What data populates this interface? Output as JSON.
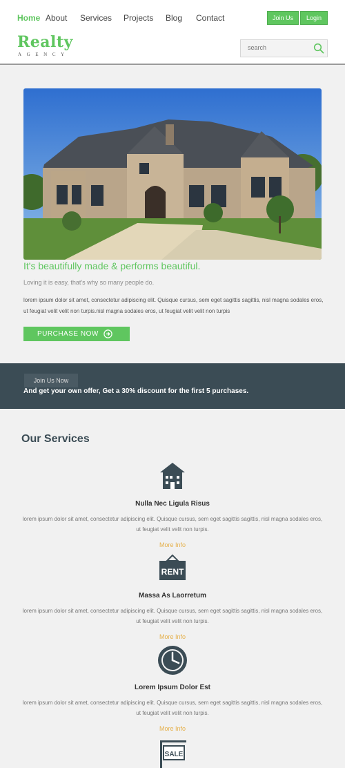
{
  "header": {
    "nav": [
      "Home",
      "About",
      "Services",
      "Projects",
      "Blog",
      "Contact"
    ],
    "join_label": "Join Us",
    "login_label": "Login",
    "logo_main": "Realty",
    "logo_sub": "AGENCY",
    "search_placeholder": "search"
  },
  "hero": {
    "title": "It's beautifully made & performs beautiful.",
    "subtitle": "Loving it is easy, that's why so many people do.",
    "body": "lorem ipsum dolor sit amet, consectetur adipiscing elit. Quisque cursus, sem eget sagittis sagittis, nisl magna sodales eros, ut feugiat velit velit non turpis.nisl magna sodales eros, ut feugiat velit velit non turpis",
    "purchase_label": "PURCHASE NOW"
  },
  "offer": {
    "join_now_label": "Join Us Now",
    "text": "And get your own offer, Get a 30% discount for the first 5 purchases."
  },
  "services": {
    "title": "Our Services",
    "items": [
      {
        "icon": "house-icon",
        "name": "Nulla Nec Ligula Risus",
        "desc": "lorem ipsum dolor sit amet, consectetur adipiscing elit. Quisque cursus, sem eget sagittis sagittis, nisl magna sodales eros, ut feugiat velit velit non turpis.",
        "more": "More Info"
      },
      {
        "icon": "rent-sign-icon",
        "icon_text": "RENT",
        "name": "Massa As Laorretum",
        "desc": "lorem ipsum dolor sit amet, consectetur adipiscing elit. Quisque cursus, sem eget sagittis sagittis, nisl magna sodales eros, ut feugiat velit velit non turpis.",
        "more": "More Info"
      },
      {
        "icon": "clock-icon",
        "name": "Lorem Ipsum Dolor Est",
        "desc": "lorem ipsum dolor sit amet, consectetur adipiscing elit. Quisque cursus, sem eget sagittis sagittis, nisl magna sodales eros, ut feugiat velit velit non turpis.",
        "more": "More Info"
      },
      {
        "icon": "sale-sign-icon",
        "icon_text": "SALE"
      }
    ]
  },
  "colors": {
    "accent_green": "#5fc65f",
    "dark_band": "#3b4c55",
    "more_link": "#e5b04a"
  }
}
